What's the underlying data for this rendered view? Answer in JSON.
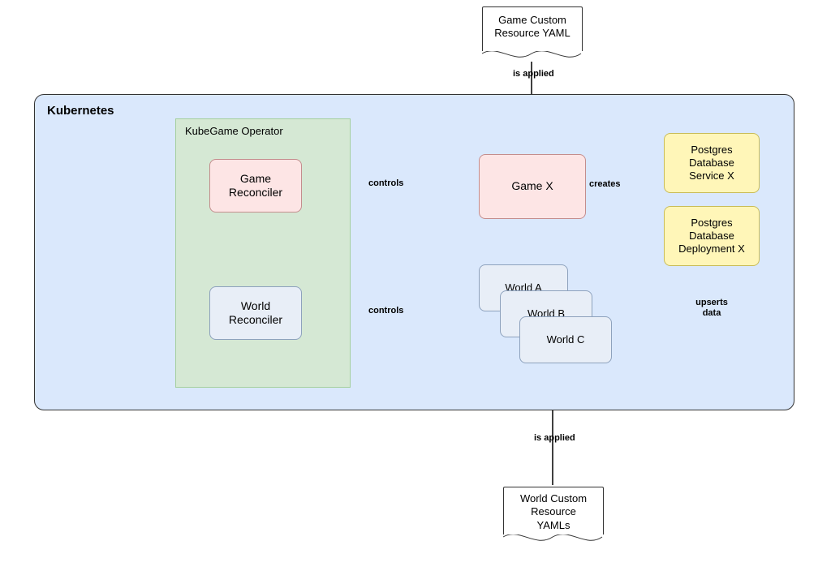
{
  "containers": {
    "k8s_label": "Kubernetes",
    "operator_label": "KubeGame Operator"
  },
  "nodes": {
    "game_reconciler": "Game\nReconciler",
    "world_reconciler": "World\nReconciler",
    "game_x": "Game X",
    "world_a": "World A",
    "world_b": "World B",
    "world_c": "World C",
    "pg_service": "Postgres\nDatabase\nService X",
    "pg_deployment": "Postgres\nDatabase\nDeployment X",
    "game_yaml": "Game Custom\nResource YAML",
    "world_yaml": "World Custom\nResource\nYAMLs"
  },
  "edges": {
    "controls1": "controls",
    "controls2": "controls",
    "creates": "creates",
    "upserts": "upserts\ndata",
    "applied1": "is applied",
    "applied2": "is applied"
  }
}
